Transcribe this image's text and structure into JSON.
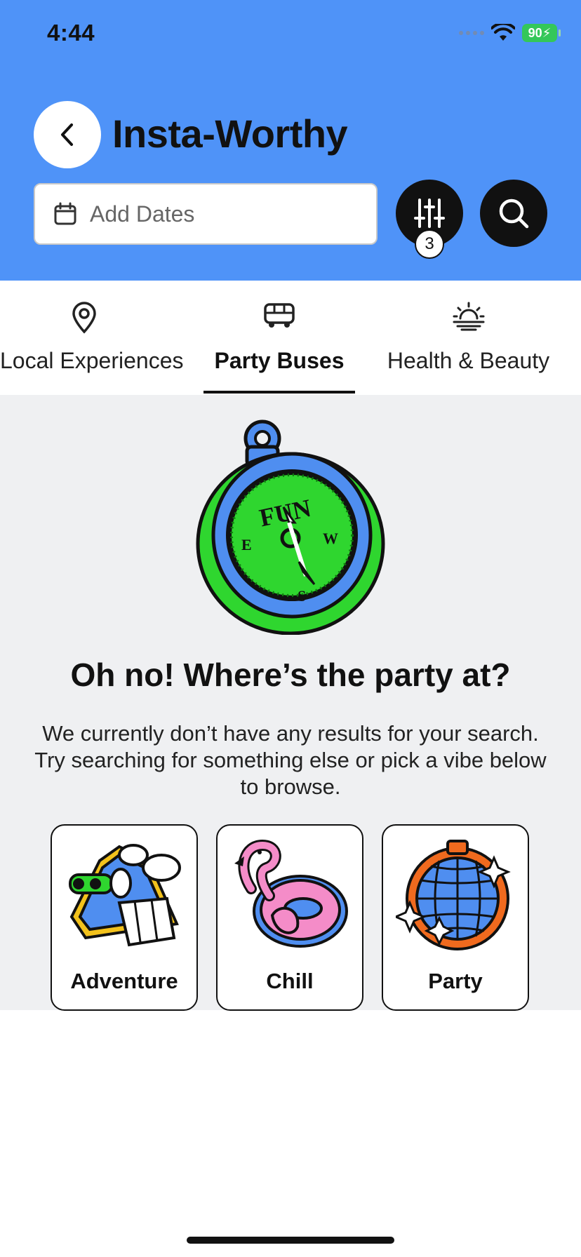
{
  "status_bar": {
    "time": "4:44",
    "battery": "90"
  },
  "header": {
    "title": "Insta-Worthy",
    "dates_placeholder": "Add Dates",
    "filter_count": "3",
    "background_color": "#4f93f8"
  },
  "tabs": [
    {
      "label": "Local Experiences",
      "icon": "map-pin-icon",
      "active": false
    },
    {
      "label": "Party Buses",
      "icon": "bus-icon",
      "active": true
    },
    {
      "label": "Health & Beauty",
      "icon": "sunrise-icon",
      "active": false
    }
  ],
  "empty_state": {
    "illustration": "compass-illustration",
    "compass_text": "FUN",
    "compass_directions": [
      "E",
      "W",
      "S"
    ],
    "title": "Oh no! Where’s the party at?",
    "description": "We currently don’t have any results for your search. Try searching for something else or pick a vibe below to browse."
  },
  "vibes": [
    {
      "label": "Adventure",
      "icon": "mountain-binoculars-illustration"
    },
    {
      "label": "Chill",
      "icon": "flamingo-float-illustration"
    },
    {
      "label": "Party",
      "icon": "disco-ball-illustration"
    }
  ]
}
